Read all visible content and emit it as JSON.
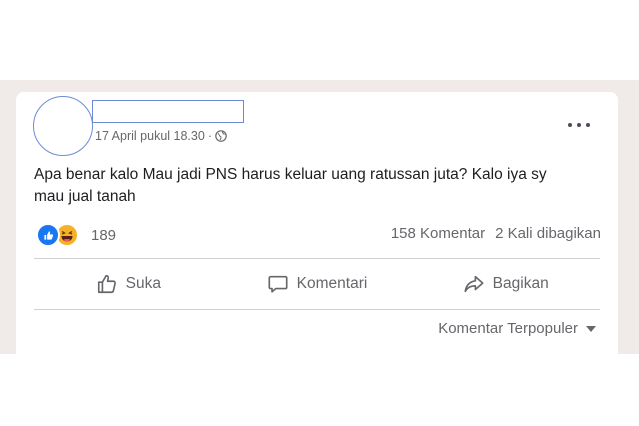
{
  "post": {
    "timestamp": "17 April pukul 18.30",
    "separator": "·",
    "privacy_icon": "globe-icon",
    "text_line1": "Apa benar kalo Mau jadi PNS harus keluar uang ratussan juta? Kalo iya sy",
    "text_line2": "mau jual tanah"
  },
  "reactions": {
    "icons": [
      "like-reaction-icon",
      "haha-reaction-icon"
    ],
    "count": "189"
  },
  "stats": {
    "comments": "158 Komentar",
    "shares": "2 Kali dibagikan"
  },
  "actions": {
    "like": "Suka",
    "comment": "Komentari",
    "share": "Bagikan"
  },
  "comments_sort": {
    "label": "Komentar Terpopuler"
  },
  "colors": {
    "background": "#f0ebe9",
    "card": "#ffffff",
    "text_primary": "#1c1e21",
    "text_secondary": "#65676b",
    "like_blue": "#1877f2",
    "haha_yellow": "#f7b125",
    "redaction_outline": "#6d8bd4"
  }
}
